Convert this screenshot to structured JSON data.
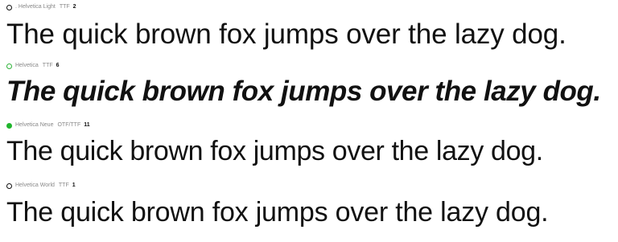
{
  "fonts": [
    {
      "name": ". Helvetica Light",
      "format": "TTF",
      "count": "2",
      "status_color": "#111111",
      "sample": "The quick brown fox jumps over the lazy dog."
    },
    {
      "name": "Helvetica",
      "format": "TTF",
      "count": "6",
      "status_color": "#2fb33a",
      "sample": "The quick brown fox jumps over the lazy dog."
    },
    {
      "name": "Helvetica Neue",
      "format": "OTF/TTF",
      "count": "11",
      "status_color": "#20b52d",
      "sample": "The quick brown fox jumps over the lazy dog."
    },
    {
      "name": "Helvetica World",
      "format": "TTF",
      "count": "1",
      "status_color": "#111111",
      "sample": "The quick brown fox jumps over the lazy dog."
    }
  ]
}
